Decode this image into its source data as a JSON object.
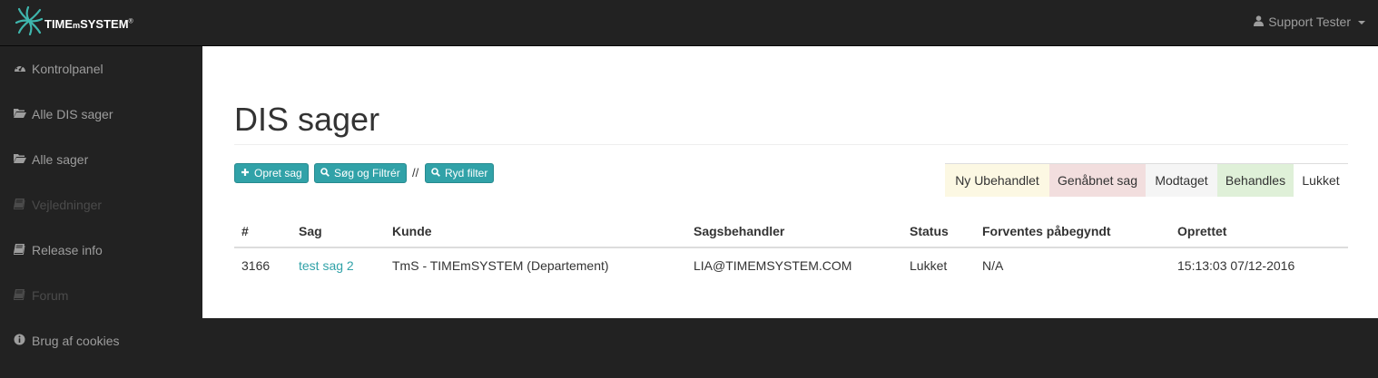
{
  "colors": {
    "accent": "#31a2a8",
    "nav_bg": "#222222",
    "nav_text": "#9d9d9d"
  },
  "header": {
    "logo_text_1": "TIME",
    "logo_text_2": "m",
    "logo_text_3": "SYSTEM",
    "logo_icon": "timemsystem-logo-icon",
    "user": "Support Tester",
    "user_icon": "user-icon"
  },
  "sidebar": {
    "items": [
      {
        "label": "Kontrolpanel",
        "icon": "dashboard-icon",
        "enabled": true
      },
      {
        "label": "Alle DIS sager",
        "icon": "folder-open-icon",
        "enabled": true
      },
      {
        "label": "Alle sager",
        "icon": "folder-open-icon",
        "enabled": true
      },
      {
        "label": "Vejledninger",
        "icon": "book-icon",
        "enabled": false
      },
      {
        "label": "Release info",
        "icon": "book-icon",
        "enabled": true
      },
      {
        "label": "Forum",
        "icon": "book-icon",
        "enabled": false
      },
      {
        "label": "Brug af cookies",
        "icon": "info-circle-icon",
        "enabled": true
      }
    ]
  },
  "main": {
    "title": "DIS sager",
    "toolbar": {
      "create_label": "Opret sag",
      "search_label": "Søg og Filtrér",
      "separator": "//",
      "clear_label": "Ryd filter"
    },
    "legend": [
      {
        "label": "Ny Ubehandlet",
        "color": "#fcf8e3"
      },
      {
        "label": "Genåbnet sag",
        "color": "#f2dede"
      },
      {
        "label": "Modtaget",
        "color": "#f5f5f5"
      },
      {
        "label": "Behandles",
        "color": "#dff0d8"
      },
      {
        "label": "Lukket",
        "color": "#ffffff"
      }
    ],
    "table": {
      "columns": [
        "#",
        "Sag",
        "Kunde",
        "Sagsbehandler",
        "Status",
        "Forventes påbegyndt",
        "Oprettet"
      ],
      "rows": [
        {
          "id": "3166",
          "sag": "test sag 2",
          "kunde": "TmS - TIMEmSYSTEM (Departement)",
          "sagsbehandler": "LIA@TIMEMSYSTEM.COM",
          "status": "Lukket",
          "forventes": "N/A",
          "oprettet": "15:13:03 07/12-2016"
        }
      ]
    }
  }
}
